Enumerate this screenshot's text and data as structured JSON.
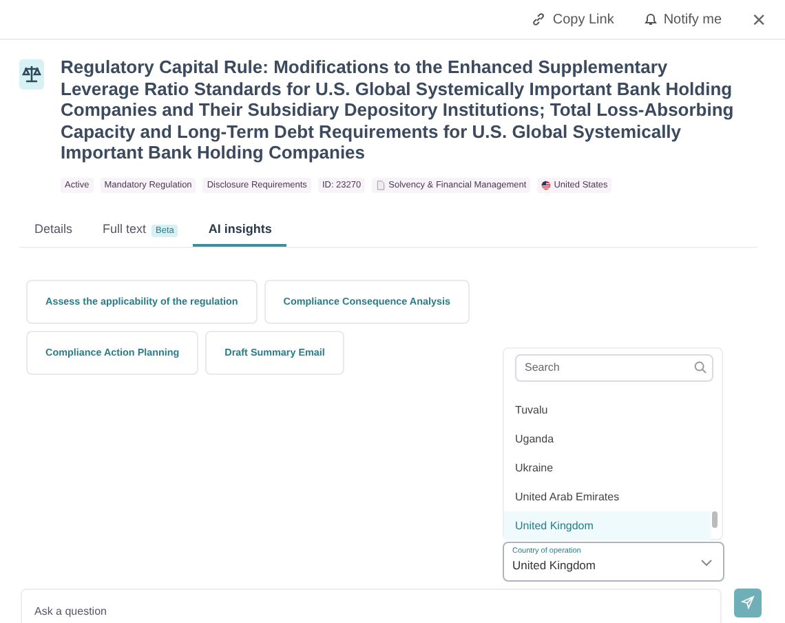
{
  "header": {
    "actions": [
      {
        "kind": "link",
        "label": "Copy Link"
      },
      {
        "kind": "bell",
        "label": "Notify me"
      }
    ],
    "close": "×"
  },
  "title": "Regulatory Capital Rule: Modifications to the Enhanced Supplementary Leverage Ratio Standards for U.S. Global Systemically Important Bank Holding Companies and Their Subsidiary Depository Institutions; Total Loss-Absorbing Capacity and Long-Term Debt Requirements for U.S. Global Systemically Important Bank Holding Companies",
  "tags": [
    {
      "kind": "plain",
      "label": "Active"
    },
    {
      "kind": "plain",
      "label": "Mandatory Regulation"
    },
    {
      "kind": "plain",
      "label": "Disclosure Requirements"
    },
    {
      "kind": "plain",
      "label": "ID: 23270"
    },
    {
      "kind": "doc",
      "label": "Solvency & Financial Management"
    },
    {
      "kind": "flag",
      "label": "United States"
    }
  ],
  "tabs": [
    {
      "label": "Details",
      "selected": false
    },
    {
      "label": "Full text",
      "badge": "Beta",
      "selected": false
    },
    {
      "label": "AI insights",
      "selected": true
    }
  ],
  "prompts": [
    "Assess the applicability of the regulation",
    "Compliance Consequence Analysis",
    "Compliance Action Planning",
    "Draft Summary Email"
  ],
  "country_dropdown": {
    "search_placeholder": "Search",
    "options": [
      {
        "label": "Tuvalu",
        "selected": false
      },
      {
        "label": "Uganda",
        "selected": false
      },
      {
        "label": "Ukraine",
        "selected": false
      },
      {
        "label": "United Arab Emirates",
        "selected": false
      },
      {
        "label": "United Kingdom",
        "selected": true
      }
    ]
  },
  "country_select": {
    "label": "Country of operation",
    "value": "United Kingdom"
  },
  "question": {
    "placeholder": "Ask a question"
  }
}
